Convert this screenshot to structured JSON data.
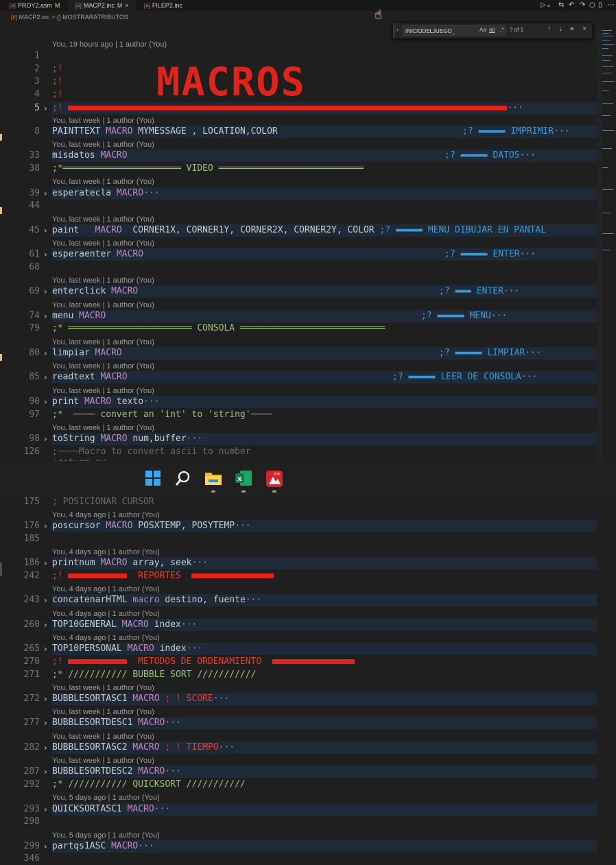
{
  "tabs": [
    {
      "label": "PROY2.asm",
      "modified": "M"
    },
    {
      "label": "MACP2.inc",
      "modified": "M"
    },
    {
      "label": "FILEP2.inc",
      "modified": ""
    }
  ],
  "breadcrumb": {
    "file": "MACP2.inc",
    "separator": ">",
    "symbol": "{} MOSTRARATRIBUTOS"
  },
  "find": {
    "query": "INICIODELJUEGO_",
    "match_case": "Aa",
    "whole_word": "ab",
    "regex": ".*",
    "count": "? of 1"
  },
  "lens": {
    "first": "You, 19 hours ago | 1 author (You)",
    "last_week": "You, last week | 1 author (You)",
    "four_days": "You, 4 days ago | 1 author (You)",
    "five_days": "You, 5 days ago | 1 author (You)"
  },
  "banner_text": "MACROS",
  "lines": {
    "l1": "1",
    "l2": "2",
    "l3": "3",
    "l4": "4",
    "l5": "5",
    "l8": "8",
    "l33": "33",
    "l38": "38",
    "l39": "39",
    "l44": "44",
    "l45": "45",
    "l61": "61",
    "l68": "68",
    "l69": "69",
    "l74": "74",
    "l79": "79",
    "l80": "80",
    "l85": "85",
    "l90": "90",
    "l97": "97",
    "l98": "98",
    "l126": "126",
    "l175": "175",
    "l176": "176",
    "l185": "185",
    "l186": "186",
    "l242": "242",
    "l243": "243",
    "l260": "260",
    "l265": "265",
    "l270": "270",
    "l271": "271",
    "l272": "272",
    "l277": "277",
    "l282": "282",
    "l287": "287",
    "l292": "292",
    "l293": "293",
    "l298": "298",
    "l299": "299",
    "l346": "346"
  },
  "code": {
    "semi_bang": ";!",
    "c8_name": "PAINTTEXT",
    "c8_kw": "MACRO",
    "c8_args": " MYMESSAGE , LOCATION,COLOR",
    "c8_comment": ";? ▬▬▬▬▬ IMPRIMIR",
    "c33_name": "misdatos",
    "c33_kw": "MACRO",
    "c33_comment": ";? ▬▬▬▬▬ DATOS",
    "c38": ";*══════════════════════ VIDEO ═══════════════════════════",
    "c39_name": "esperatecla",
    "c39_kw": "MACRO",
    "c45_name": "paint",
    "c45_kw": "MACRO",
    "c45_args": "  CORNER1X, CORNER1Y, CORNER2X, CORNER2Y, COLOR ",
    "c45_comment": ";? ▬▬▬▬▬ MENU DIBUJAR EN PANTAL",
    "c61_name": "esperaenter",
    "c61_kw": "MACRO",
    "c61_comment": ";? ▬▬▬▬▬ ENTER",
    "c69_name": "enterclick",
    "c69_kw": "MACRO",
    "c69_comment": ";? ▬▬▬ ENTER",
    "c74_name": "menu",
    "c74_kw": "MACRO",
    "c74_comment": ";? ▬▬▬▬▬ MENU",
    "c79": ";* ═══════════════════════ CONSOLA ═══════════════════════════",
    "c80_name": "limpiar",
    "c80_kw": "MACRO",
    "c80_comment": ";? ▬▬▬▬▬ LIMPIAR",
    "c85_name": "readtext",
    "c85_kw": "MACRO",
    "c85_comment": ";? ▬▬▬▬▬ LEER DE CONSOLA",
    "c90_name": "print",
    "c90_kw": "MACRO",
    "c90_args": " texto",
    "c97": ";*  ──── convert an 'int' to 'string'────",
    "c98_name": "toString",
    "c98_kw": "MACRO",
    "c98_args": " num,buffer",
    "c126": ";────Macro to convert ascii to number",
    "c127": ";return ax",
    "c175": "; POSICIONAR CURSOR",
    "c176_name": "poscursor",
    "c176_kw": "MACRO",
    "c176_args": " POSXTEMP, POSYTEMP",
    "c186_name": "printnum",
    "c186_kw": "MACRO",
    "c186_args": " array, seek",
    "c242_text": "REPORTES",
    "c243_name": "concatenarHTML",
    "c243_kw": "macro",
    "c243_args": " destino, fuente",
    "c260_name": "TOP10GENERAL",
    "c260_kw": "MACRO",
    "c260_args": " index",
    "c265_name": "TOP10PERSONAL",
    "c265_kw": "MACRO",
    "c265_args": " index",
    "c270_text": "METODOS DE ORDENAMIENTO",
    "c271": ";* /////////// BUBBLE SORT ///////////",
    "c272_name": "BUBBLESORTASC1",
    "c272_kw": "MACRO",
    "c272_comment": " ; ! SCORE",
    "c277_name": "BUBBLESORTDESC1",
    "c277_kw": "MACRO",
    "c282_name": "BUBBLESORTASC2",
    "c282_kw": "MACRO",
    "c282_comment": " ; ! TIEMPO",
    "c287_name": "BUBBLESORTDESC2",
    "c287_kw": "MACRO",
    "c292": ";* /////////// QUICKSORT ///////////",
    "c293_name": "QUICKSORTASC1",
    "c293_kw": "MACRO",
    "c299_name": "partqs1ASC",
    "c299_kw": "MACRO",
    "ellipsis": "···"
  },
  "taskbar": {
    "icons": [
      "windows-start-icon",
      "search-icon",
      "file-explorer-icon",
      "excel-icon",
      "pdf-reader-icon"
    ],
    "pdf_badge": "PDF",
    "excel_letter": "x"
  },
  "colors": {
    "keyword": "#c586c0",
    "bang_comment": "#ef3b2a",
    "question_comment": "#3a9ad9",
    "star_comment": "#98c379",
    "highlight": "#1e2a38"
  }
}
